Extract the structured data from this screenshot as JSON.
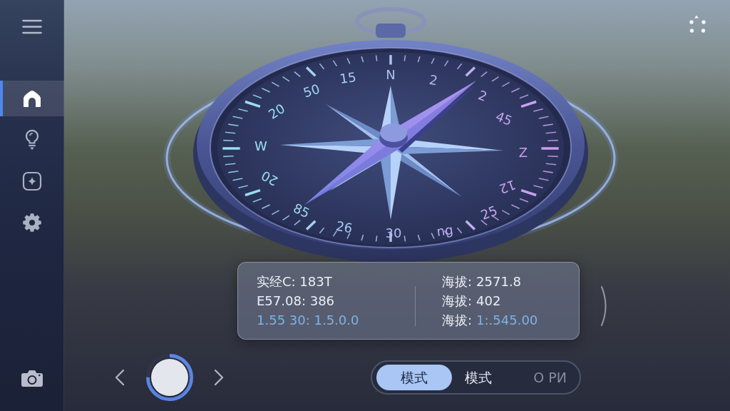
{
  "sidebar": {
    "items": [
      {
        "selected": true
      },
      {
        "selected": false
      },
      {
        "selected": false
      },
      {
        "selected": false
      }
    ]
  },
  "compass": {
    "dial_labels": [
      "N",
      "2",
      "2",
      "45",
      "Z",
      "12",
      "25",
      "ng",
      "30",
      "26",
      "85",
      "20",
      "W",
      "20",
      "50",
      "15"
    ]
  },
  "readout": {
    "left": [
      {
        "text": "实经C: 183T",
        "highlighted": false
      },
      {
        "text": "E57.08: 386",
        "highlighted": false
      },
      {
        "text": "1.55 30: 1.5.0.0",
        "highlighted": true
      }
    ],
    "right": [
      {
        "label": "海拔:",
        "value": "2571.8",
        "highlighted": false
      },
      {
        "label": "海拔:",
        "value": "402",
        "highlighted": false
      },
      {
        "label": "海拔:",
        "value": "1:.545.00",
        "highlighted": true
      }
    ]
  },
  "mode_switch": {
    "options": [
      {
        "label": "模式",
        "selected": true,
        "disabled": false
      },
      {
        "label": "模式",
        "selected": false,
        "disabled": false
      },
      {
        "label": "O PИ",
        "selected": false,
        "disabled": true
      }
    ]
  }
}
